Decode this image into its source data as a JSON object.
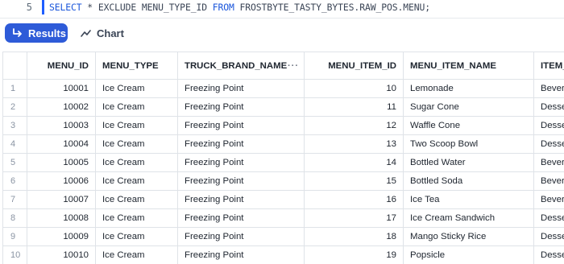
{
  "editor": {
    "line_number": "5",
    "kw_select": "SELECT",
    "code_mid": " * EXCLUDE MENU_TYPE_ID ",
    "kw_from": "FROM",
    "code_end": " FROSTBYTE_TASTY_BYTES.RAW_POS.MENU;"
  },
  "toolbar": {
    "results_label": "Results",
    "chart_label": "Chart",
    "accent": "#2e5bd8"
  },
  "table": {
    "columns": [
      "MENU_ID",
      "MENU_TYPE",
      "TRUCK_BRAND_NAME",
      "MENU_ITEM_ID",
      "MENU_ITEM_NAME",
      "ITEM_"
    ],
    "rows": [
      [
        "1",
        "10001",
        "Ice Cream",
        "Freezing Point",
        "10",
        "Lemonade",
        "Bevera"
      ],
      [
        "2",
        "10002",
        "Ice Cream",
        "Freezing Point",
        "11",
        "Sugar Cone",
        "Desse"
      ],
      [
        "3",
        "10003",
        "Ice Cream",
        "Freezing Point",
        "12",
        "Waffle Cone",
        "Desse"
      ],
      [
        "4",
        "10004",
        "Ice Cream",
        "Freezing Point",
        "13",
        "Two Scoop Bowl",
        "Desse"
      ],
      [
        "5",
        "10005",
        "Ice Cream",
        "Freezing Point",
        "14",
        "Bottled Water",
        "Bevera"
      ],
      [
        "6",
        "10006",
        "Ice Cream",
        "Freezing Point",
        "15",
        "Bottled Soda",
        "Bevera"
      ],
      [
        "7",
        "10007",
        "Ice Cream",
        "Freezing Point",
        "16",
        "Ice Tea",
        "Bevera"
      ],
      [
        "8",
        "10008",
        "Ice Cream",
        "Freezing Point",
        "17",
        "Ice Cream Sandwich",
        "Desse"
      ],
      [
        "9",
        "10009",
        "Ice Cream",
        "Freezing Point",
        "18",
        "Mango Sticky Rice",
        "Desse"
      ],
      [
        "10",
        "10010",
        "Ice Cream",
        "Freezing Point",
        "19",
        "Popsicle",
        "Desse"
      ]
    ]
  }
}
